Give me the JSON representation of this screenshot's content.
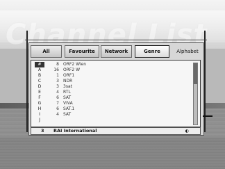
{
  "tabs": [
    {
      "label": "All",
      "active": false
    },
    {
      "label": "Favourite",
      "active": false
    },
    {
      "label": "Network",
      "active": false
    },
    {
      "label": "Genre",
      "active": true
    },
    {
      "label": "Alphabet",
      "active": false
    }
  ],
  "letters": [
    "#",
    "A",
    "B",
    "C",
    "D",
    "E",
    "F",
    "G",
    "H",
    "I",
    "J"
  ],
  "channels": [
    {
      "num": "8",
      "name": "ORF2 Wien"
    },
    {
      "num": "16",
      "name": "ORF2 W"
    },
    {
      "num": "1",
      "name": "ORF1"
    },
    {
      "num": "3",
      "name": "NDR"
    },
    {
      "num": "3",
      "name": "3sat"
    },
    {
      "num": "4",
      "name": "RTL"
    },
    {
      "num": "6",
      "name": "SAT"
    },
    {
      "num": "7",
      "name": "VIVA"
    },
    {
      "num": "6",
      "name": "SAT.1"
    },
    {
      "num": "4",
      "name": "SAT"
    }
  ],
  "footer": {
    "num": "3",
    "name": "RAI International",
    "icon": "sound-icon"
  },
  "background_title": "Channel List"
}
